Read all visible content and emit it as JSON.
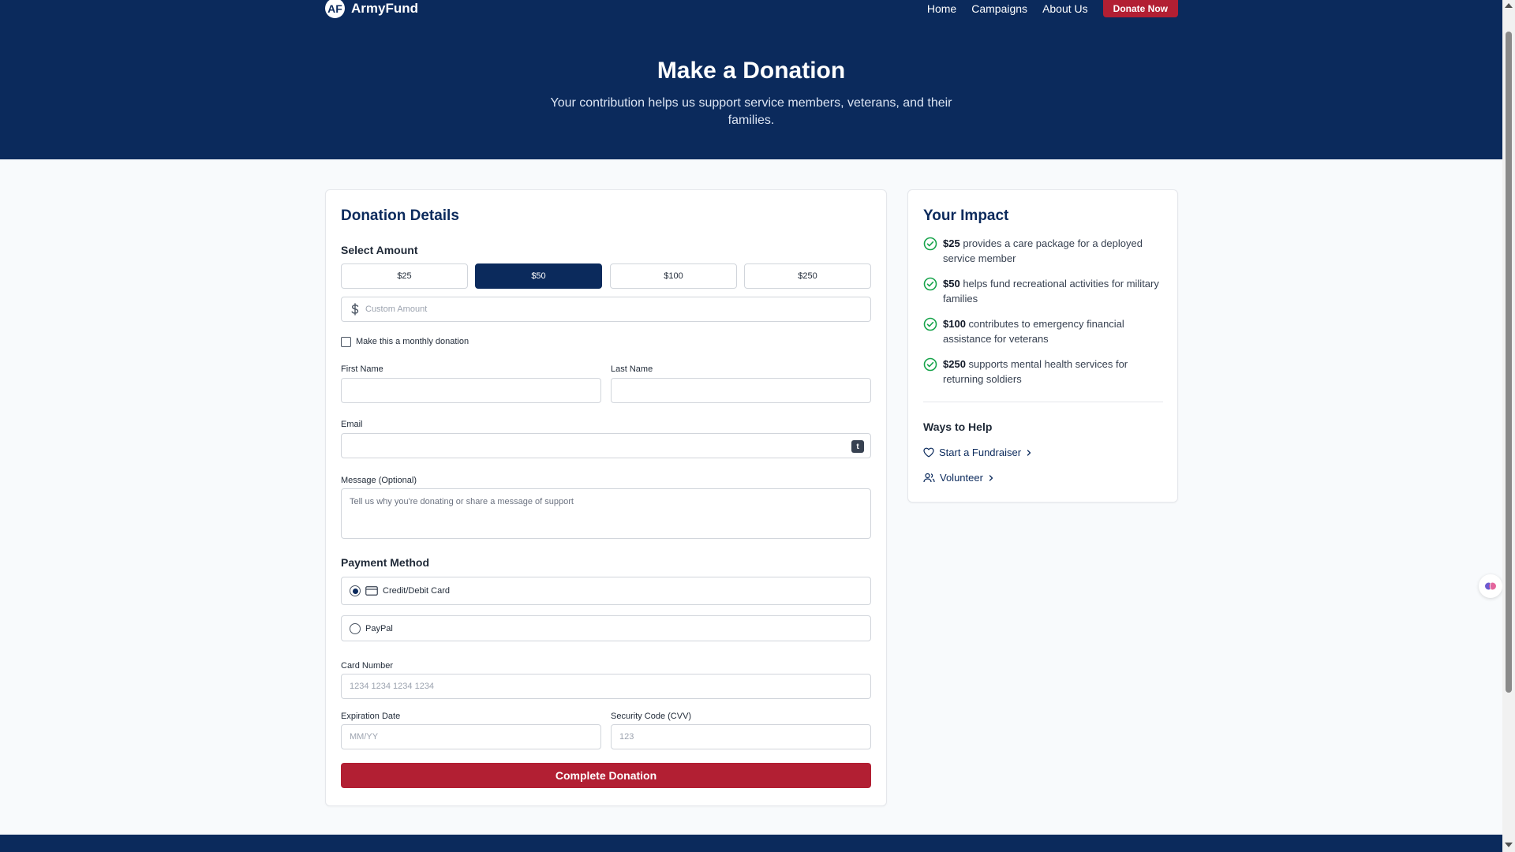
{
  "nav": {
    "logo_badge": "AF",
    "logo_text": "ArmyFund",
    "links": [
      "Home",
      "Campaigns",
      "About Us"
    ],
    "donate_now": "Donate Now"
  },
  "hero": {
    "title": "Make a Donation",
    "subtitle": "Your contribution helps us support service members, veterans, and their families."
  },
  "form": {
    "title": "Donation Details",
    "select_amount": "Select Amount",
    "amounts": [
      "$25",
      "$50",
      "$100",
      "$250"
    ],
    "selected_amount": "$50",
    "custom_amount_placeholder": "Custom Amount",
    "monthly_label": "Make this a monthly donation",
    "first_name": "First Name",
    "last_name": "Last Name",
    "email": "Email",
    "message_label": "Message (Optional)",
    "message_placeholder": "Tell us why you're donating or share a message of support",
    "payment_method": "Payment Method",
    "payment_options": [
      "Credit/Debit Card",
      "PayPal"
    ],
    "selected_payment": "Credit/Debit Card",
    "card_number": "Card Number",
    "card_number_placeholder": "1234 1234 1234 1234",
    "expiration": "Expiration Date",
    "expiration_placeholder": "MM/YY",
    "cvv": "Security Code (CVV)",
    "cvv_placeholder": "123",
    "submit": "Complete Donation"
  },
  "impact": {
    "title": "Your Impact",
    "items": [
      {
        "amount": "$25",
        "text": " provides a care package for a deployed service member"
      },
      {
        "amount": "$50",
        "text": " helps fund recreational activities for military families"
      },
      {
        "amount": "$100",
        "text": " contributes to emergency financial assistance for veterans"
      },
      {
        "amount": "$250",
        "text": " supports mental health services for returning soldiers"
      }
    ],
    "ways_title": "Ways to Help",
    "ways": [
      "Start a Fundraiser",
      "Volunteer"
    ]
  },
  "colors": {
    "navy": "#0b2a5c",
    "red": "#b21f33",
    "green": "#16a34a"
  },
  "icons": [
    "dollar-icon",
    "credit-card-icon",
    "check-circle-icon",
    "heart-icon",
    "users-icon",
    "chevron-right-icon",
    "autofill-icon",
    "assistant-icon"
  ]
}
